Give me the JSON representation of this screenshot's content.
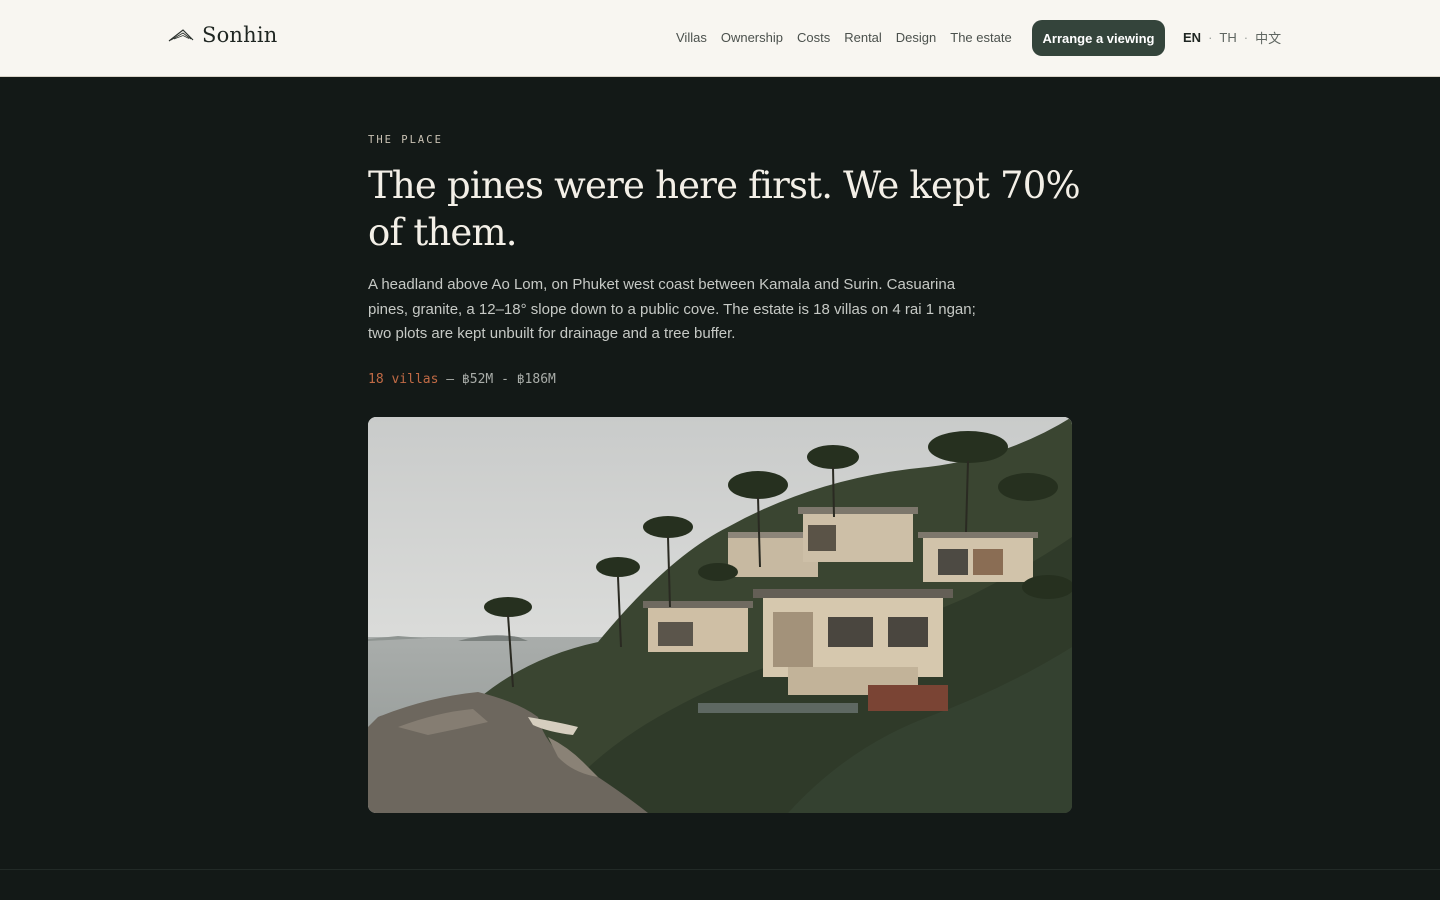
{
  "header": {
    "brand": "Sonhin",
    "nav": [
      "Villas",
      "Ownership",
      "Costs",
      "Rental",
      "Design",
      "The estate"
    ],
    "cta_label": "Arrange a viewing",
    "languages": [
      "EN",
      "TH",
      "中文"
    ],
    "active_language": "EN"
  },
  "main": {
    "eyebrow": "THE PLACE",
    "headline": "The pines were here first. We kept 70% of them.",
    "intro": "A headland above Ao Lom, on Phuket west coast between Kamala and Surin. Casuarina pines, granite, a 12–18° slope down to a public cove. The estate is 18 villas on 4 rai 1 ngan; two plots are kept unbuilt for drainage and a tree buffer.",
    "villa_count": "18 villas",
    "price_range": "— ฿52M - ฿186M"
  },
  "colors": {
    "header_bg": "#f8f6f1",
    "page_bg": "#131917",
    "cta_bg": "#34443b",
    "accent": "#c06a45"
  }
}
